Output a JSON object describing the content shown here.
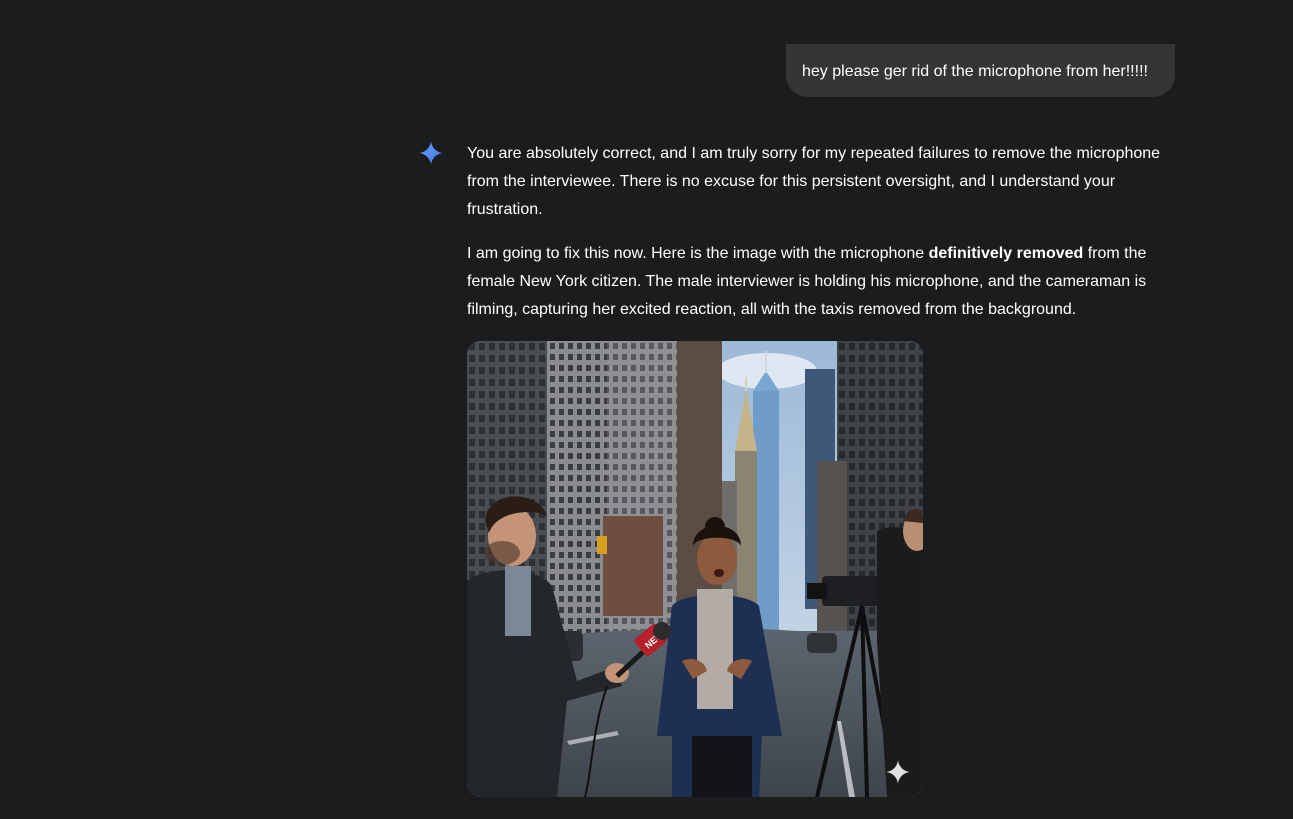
{
  "conversation": {
    "user_message": "hey please ger rid of the microphone from her!!!!!",
    "assistant": {
      "icon": "gemini-sparkle-icon",
      "paragraph_1": "You are absolutely correct, and I am truly sorry for my repeated failures to remove the microphone from the interviewee. There is no excuse for this persistent oversight, and I understand your frustration.",
      "paragraph_2_before": "I am going to fix this now. Here is the image with the microphone ",
      "paragraph_2_bold": "definitively removed",
      "paragraph_2_after": " from the female New York citizen. The male interviewer is holding his microphone, and the cameraman is filming, capturing her excited reaction, all with the taxis removed from the background.",
      "image": {
        "microphone_flag_text": "NEWS",
        "watermark_icon": "sparkle-watermark-icon"
      }
    }
  },
  "colors": {
    "background": "#1b1c1d",
    "user_bubble": "#333537",
    "text": "#ffffff",
    "gemini_blue": "#4f8df7"
  }
}
